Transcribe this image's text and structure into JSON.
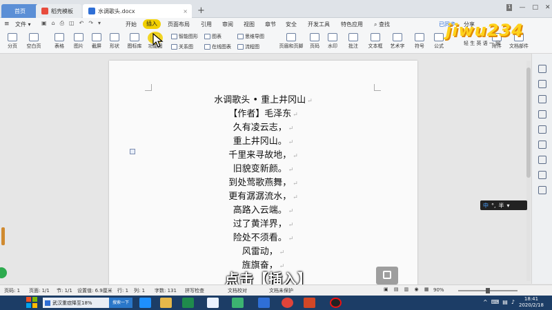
{
  "tabs": [
    {
      "label": "首页"
    },
    {
      "label": "稻壳模板"
    },
    {
      "label": "水调歌头.docx"
    }
  ],
  "menu": {
    "file": "文件",
    "items": [
      "开始",
      "插入",
      "页面布局",
      "引用",
      "审阅",
      "视图",
      "章节",
      "安全",
      "开发工具",
      "特色应用"
    ],
    "search": "查找",
    "sync": "已同步",
    "share": "分享"
  },
  "ribbon": {
    "buttons": [
      "分页",
      "空白页",
      "表格",
      "图片",
      "截屏",
      "形状",
      "图标库",
      "功能图",
      "页眉和页脚",
      "页码",
      "水印",
      "批注",
      "文本框",
      "艺术字",
      "符号",
      "公式",
      "附件",
      "文档部件"
    ],
    "small": [
      "智能图形",
      "图表",
      "思维导图",
      "关系图",
      "在线图表",
      "流程图"
    ]
  },
  "watermark": {
    "text": "jiwu234",
    "sub": "轻 生 英 语 一 网"
  },
  "document": {
    "lines": [
      "水调歌头 • 重上井冈山",
      "【作者】毛泽东",
      "久有凌云志，",
      "重上井冈山。",
      "千里来寻故地，",
      "旧貌变新颜。",
      "到处莺歌燕舞，",
      "更有潺潺流水，",
      "高路入云端。",
      "过了黄洋界，",
      "险处不须看。",
      "风雷动，",
      "旌旗奋，"
    ]
  },
  "caption": "点击【插入】",
  "ime": {
    "lang": "中",
    "mode": "半"
  },
  "status": {
    "page": "页码: 1",
    "pages": "页面: 1/1",
    "section": "节: 1/1",
    "position": "设置值: 6.9厘米",
    "row": "行: 1",
    "col": "列: 1",
    "words": "字数: 131",
    "spell": "拼写检查",
    "proof": "文档校对",
    "protect": "文档未保护",
    "zoom": "90%"
  },
  "taskbar": {
    "news": "武汉重症降至18%",
    "search": "搜索一下",
    "time": "18:41",
    "date": "2020/2/18"
  },
  "colors": {
    "accent": "#f2d000",
    "taskbar": "#1c3d66",
    "active_tab": "#ffffff"
  }
}
